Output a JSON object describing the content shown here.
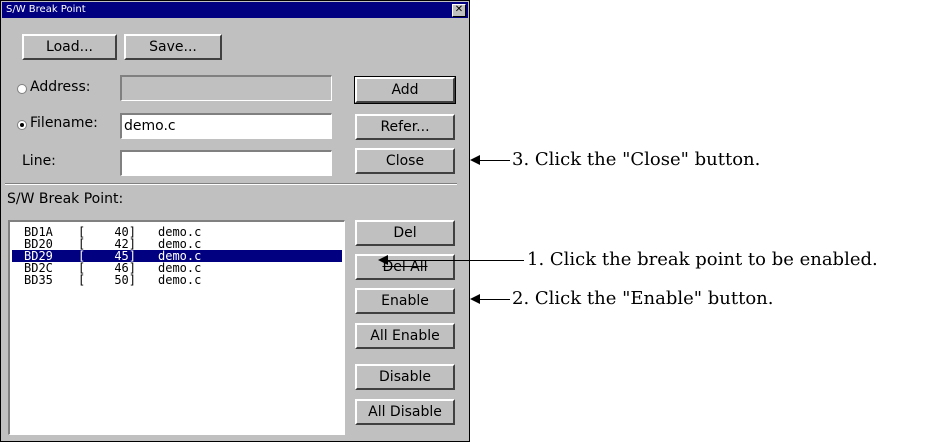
{
  "dialog": {
    "title": "S/W Break Point",
    "close_glyph": "✕",
    "load_label": "Load...",
    "save_label": "Save...",
    "address_label": "Address:",
    "address_value": "",
    "filename_label": "Filename:",
    "filename_value": "demo.c",
    "line_label": "Line:",
    "line_value": "",
    "add_label": "Add",
    "refer_label": "Refer...",
    "close_label": "Close",
    "list_title": "S/W Break Point:",
    "breakpoints": [
      {
        "name": "BD1A",
        "open": "[",
        "line": "40]",
        "file": "demo.c"
      },
      {
        "name": "BD20",
        "open": "[",
        "line": "42]",
        "file": "demo.c"
      },
      {
        "name": "BD29",
        "open": "[",
        "line": "45]",
        "file": "demo.c"
      },
      {
        "name": "BD2C",
        "open": "[",
        "line": "46]",
        "file": "demo.c"
      },
      {
        "name": "BD35",
        "open": "[",
        "line": "50]",
        "file": "demo.c"
      }
    ],
    "selected_row": "BD29",
    "del_label": "Del",
    "del_all_label": "Del All",
    "enable_label": "Enable",
    "all_enable_label": "All Enable",
    "disable_label": "Disable",
    "all_disable_label": "All Disable"
  },
  "callouts": {
    "step1": "1. Click the break point to be enabled.",
    "step2": "2. Click the \"Enable\" button.",
    "step3": "3. Click the \"Close\" button."
  }
}
